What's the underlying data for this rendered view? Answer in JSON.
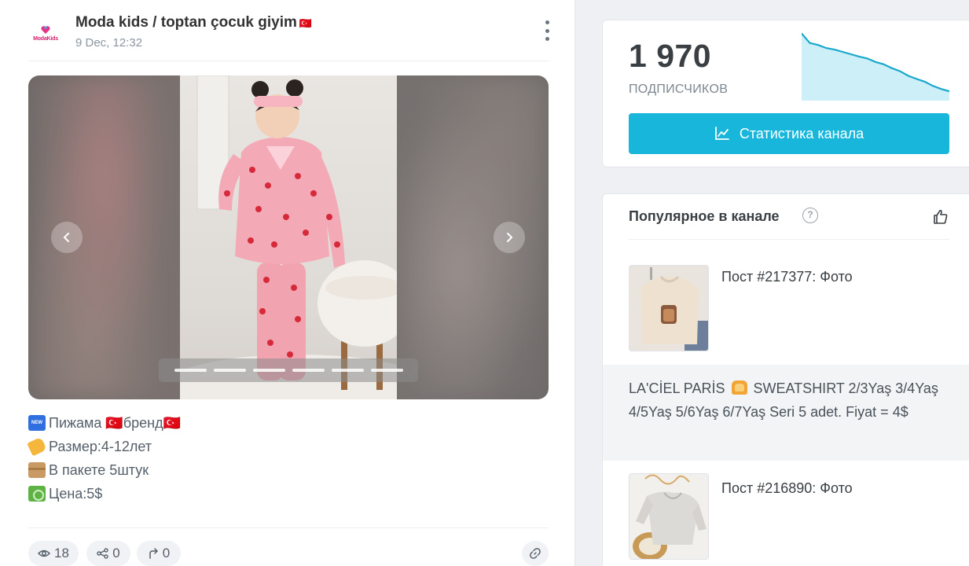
{
  "post": {
    "channel_name": "Moda kids / toptan çocuk giyim",
    "channel_flag": "🇹🇷",
    "avatar_text": "ModaKids",
    "date": "9 Dec, 12:32",
    "gallery": {
      "slide_count": 6,
      "active_slide": 1
    },
    "lines": [
      {
        "icon": "new-emoji-icon",
        "text": "Пижама 🇹🇷бренд🇹🇷"
      },
      {
        "icon": "label-tag-icon",
        "text": "Размер:4-12лет"
      },
      {
        "icon": "package-box-icon",
        "text": "В пакете 5штук"
      },
      {
        "icon": "money-icon",
        "text": "Цена:5$"
      }
    ],
    "stats": {
      "views": "18",
      "shares": "0",
      "forwards": "0"
    }
  },
  "subscribers": {
    "count": "1 970",
    "label": "ПОДПИСЧИКОВ",
    "button_label": "Статистика канала",
    "trend": [
      2120,
      2095,
      2090,
      2082,
      2078,
      2072,
      2066,
      2060,
      2055,
      2046,
      2040,
      2030,
      2022,
      2010,
      2002,
      1995,
      1984,
      1976,
      1970
    ],
    "accent_color": "#18b6da"
  },
  "popular": {
    "title": "Популярное в канале",
    "items": [
      {
        "label": "Пост #217377: Фото"
      },
      {
        "label": "Пост #216890: Фото"
      }
    ],
    "text_post": {
      "before_emoji": "LA'CİEL PARİS",
      "after_emoji": "SWEATSHIRT 2/3Yaş 3/4Yaş 4/5Yaş 5/6Yaş 6/7Yaş Seri 5 adet. Fiyat = 4$"
    }
  }
}
